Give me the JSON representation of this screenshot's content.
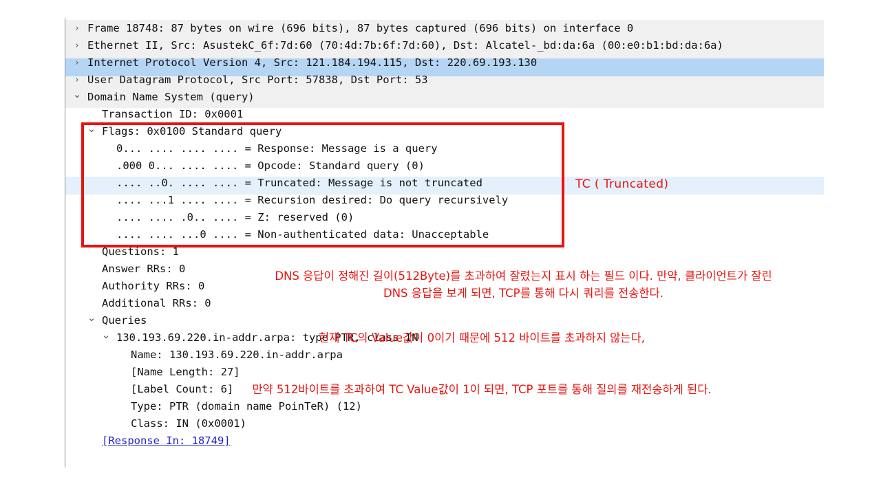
{
  "pane": {
    "name": "packet-details-tree",
    "rows": [
      {
        "indent": 0,
        "twisty": "collapsed",
        "text": "Frame 18748: 87 bytes on wire (696 bits), 87 bytes captured (696 bits) on interface 0",
        "style": "gray"
      },
      {
        "indent": 0,
        "twisty": "collapsed",
        "text": "Ethernet II, Src: AsustekC_6f:7d:60 (70:4d:7b:6f:7d:60), Dst: Alcatel-_bd:da:6a (00:e0:b1:bd:da:6a)",
        "style": "gray"
      },
      {
        "indent": 0,
        "twisty": "collapsed",
        "text": "Internet Protocol Version 4, Src: 121.184.194.115, Dst: 220.69.193.130",
        "style": "selected"
      },
      {
        "indent": 0,
        "twisty": "collapsed",
        "text": "User Datagram Protocol, Src Port: 57838, Dst Port: 53",
        "style": "gray"
      },
      {
        "indent": 0,
        "twisty": "expanded",
        "text": "Domain Name System (query)",
        "style": "gray"
      },
      {
        "indent": 1,
        "twisty": "none",
        "text": "Transaction ID: 0x0001",
        "style": "plain"
      },
      {
        "indent": 1,
        "twisty": "expanded",
        "text": "Flags: 0x0100 Standard query",
        "style": "plain"
      },
      {
        "indent": 2,
        "twisty": "none",
        "text": "0... .... .... .... = Response: Message is a query",
        "style": "plain"
      },
      {
        "indent": 2,
        "twisty": "none",
        "text": ".000 0... .... .... = Opcode: Standard query (0)",
        "style": "plain"
      },
      {
        "indent": 2,
        "twisty": "none",
        "text": ".... ..0. .... .... = Truncated: Message is not truncated",
        "style": "tc-highlight"
      },
      {
        "indent": 2,
        "twisty": "none",
        "text": ".... ...1 .... .... = Recursion desired: Do query recursively",
        "style": "plain"
      },
      {
        "indent": 2,
        "twisty": "none",
        "text": ".... .... .0.. .... = Z: reserved (0)",
        "style": "plain"
      },
      {
        "indent": 2,
        "twisty": "none",
        "text": ".... .... ...0 .... = Non-authenticated data: Unacceptable",
        "style": "plain"
      },
      {
        "indent": 1,
        "twisty": "none",
        "text": "Questions: 1",
        "style": "plain"
      },
      {
        "indent": 1,
        "twisty": "none",
        "text": "Answer RRs: 0",
        "style": "plain"
      },
      {
        "indent": 1,
        "twisty": "none",
        "text": "Authority RRs: 0",
        "style": "plain"
      },
      {
        "indent": 1,
        "twisty": "none",
        "text": "Additional RRs: 0",
        "style": "plain"
      },
      {
        "indent": 1,
        "twisty": "expanded",
        "text": "Queries",
        "style": "plain"
      },
      {
        "indent": 2,
        "twisty": "expanded",
        "text": "130.193.69.220.in-addr.arpa: type PTR, class IN",
        "style": "plain"
      },
      {
        "indent": 3,
        "twisty": "none",
        "text": "Name: 130.193.69.220.in-addr.arpa",
        "style": "plain"
      },
      {
        "indent": 3,
        "twisty": "none",
        "text": "[Name Length: 27]",
        "style": "plain"
      },
      {
        "indent": 3,
        "twisty": "none",
        "text": "[Label Count: 6]",
        "style": "plain"
      },
      {
        "indent": 3,
        "twisty": "none",
        "text": "Type: PTR (domain name PoinTeR) (12)",
        "style": "plain"
      },
      {
        "indent": 3,
        "twisty": "none",
        "text": "Class: IN (0x0001)",
        "style": "plain"
      },
      {
        "indent": 1,
        "twisty": "none",
        "text": "[Response In: 18749]",
        "style": "link"
      }
    ]
  },
  "annotations": {
    "highlight_box_label": "red-rectangle-around-dns-flags",
    "tc_label": "TC ( Truncated)",
    "note1_line1": "DNS 응답이 정해진 길이(512Byte)를 초과하여 잘렸는지 표시 하는 필드 이다. 만약, 클라이언트가 잘린",
    "note1_line2": "DNS 응답을 보게 되면, TCP를 통해 다시 쿼리를 전송한다.",
    "note2_line1": "현재 TC의 Value값이 0이기 때문에 512 바이트를 초과하지 않는다,",
    "note2_line2": "만약 512바이트를 초과하여 TC Value값이 1이 되면, TCP 포트를 통해 질의를 재전송하게 된다."
  },
  "colors": {
    "annotation_red": "#e8140f",
    "selected_row_blue": "#b5d5f5",
    "highlight_row_blue": "#e4f0fb",
    "panel_gray": "#f0f0f0",
    "link_blue": "#2222cc"
  },
  "icons": {
    "collapsed": "›",
    "expanded": "⌄"
  }
}
